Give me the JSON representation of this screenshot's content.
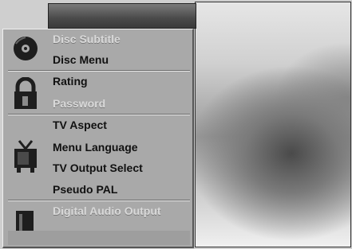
{
  "menu": {
    "groups": [
      {
        "icon": "disc-icon",
        "items": [
          {
            "label": "Disc Subtitle",
            "enabled": false
          },
          {
            "label": "Disc Menu",
            "enabled": true
          }
        ]
      },
      {
        "icon": "lock-icon",
        "items": [
          {
            "label": "Rating",
            "enabled": true
          },
          {
            "label": "Password",
            "enabled": false
          }
        ]
      },
      {
        "icon": "tv-icon",
        "items": [
          {
            "label": "TV Aspect",
            "enabled": true
          },
          {
            "label": "Menu Language",
            "enabled": true
          },
          {
            "label": "TV Output Select",
            "enabled": true
          },
          {
            "label": "Pseudo PAL",
            "enabled": true
          }
        ]
      },
      {
        "icon": "speaker-icon",
        "items": [
          {
            "label": "Digital Audio Output",
            "enabled": false
          }
        ]
      }
    ]
  }
}
